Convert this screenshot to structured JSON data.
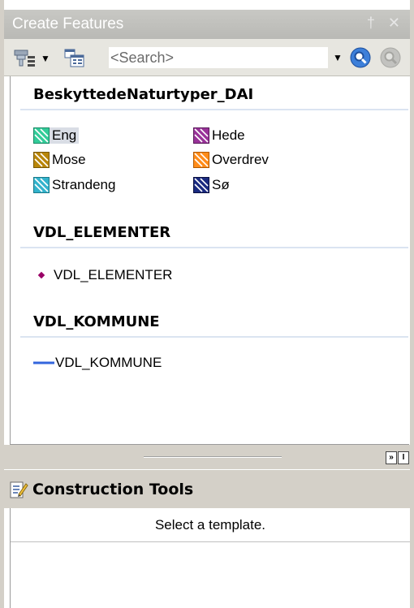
{
  "titlebar": {
    "title": "Create Features",
    "pin_glyph": "†",
    "close_glyph": "✕"
  },
  "toolbar": {
    "filter_icon": "filter-templates-icon",
    "organize_icon": "organize-templates-icon",
    "search_placeholder": "<Search>",
    "search_button_icon": "magnifier-icon",
    "clear_button_icon": "clear-search-icon"
  },
  "layers": [
    {
      "name": "BeskyttedeNaturtyper_DAI",
      "templates": [
        {
          "label": "Eng",
          "color": "#33cc99",
          "selected": true
        },
        {
          "label": "Hede",
          "color": "#993399",
          "selected": false
        },
        {
          "label": "Mose",
          "color": "#b8860b",
          "selected": false
        },
        {
          "label": "Overdrev",
          "color": "#ff8c1a",
          "selected": false
        },
        {
          "label": "Strandeng",
          "color": "#33b3cc",
          "selected": false
        },
        {
          "label": "Sø",
          "color": "#1a2a80",
          "selected": false
        }
      ]
    },
    {
      "name": "VDL_ELEMENTER",
      "templates": [
        {
          "label": "VDL_ELEMENTER",
          "symbol": "point",
          "color": "#990066"
        }
      ]
    },
    {
      "name": "VDL_KOMMUNE",
      "templates": [
        {
          "label": "VDL_KOMMUNE",
          "symbol": "line",
          "color": "#3366dd"
        }
      ]
    }
  ],
  "splitter": {
    "collapse_glyph": "»",
    "restore_glyph": "I"
  },
  "construction": {
    "title": "Construction Tools",
    "message": "Select a template."
  }
}
